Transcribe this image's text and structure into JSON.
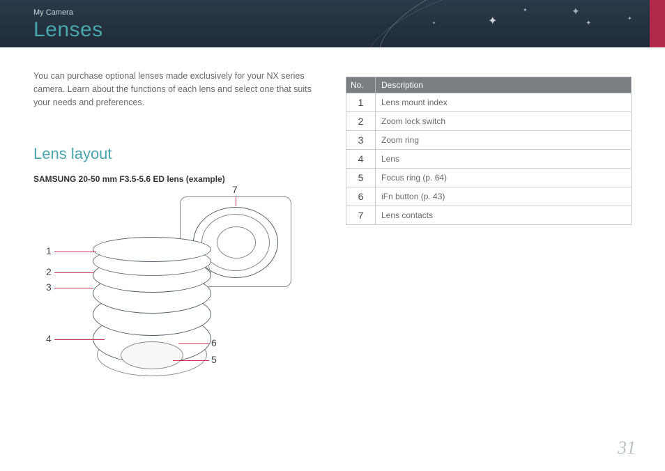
{
  "header": {
    "breadcrumb": "My Camera",
    "title": "Lenses"
  },
  "intro": "You can purchase optional lenses made exclusively for your NX series camera. Learn about the functions of each lens and select one that suits your needs and preferences.",
  "section_title": "Lens layout",
  "example_label": "SAMSUNG 20-50 mm F3.5-5.6 ED lens (example)",
  "diagram": {
    "callouts": [
      "1",
      "2",
      "3",
      "4",
      "5",
      "6",
      "7"
    ]
  },
  "table": {
    "headers": {
      "no": "No.",
      "desc": "Description"
    },
    "rows": [
      {
        "no": "1",
        "desc": "Lens mount index"
      },
      {
        "no": "2",
        "desc": "Zoom lock switch"
      },
      {
        "no": "3",
        "desc": "Zoom ring"
      },
      {
        "no": "4",
        "desc": "Lens"
      },
      {
        "no": "5",
        "desc": "Focus ring (p. 64)"
      },
      {
        "no": "6",
        "desc": "iFn button (p. 43)"
      },
      {
        "no": "7",
        "desc": "Lens contacts"
      }
    ]
  },
  "page_number": "31"
}
